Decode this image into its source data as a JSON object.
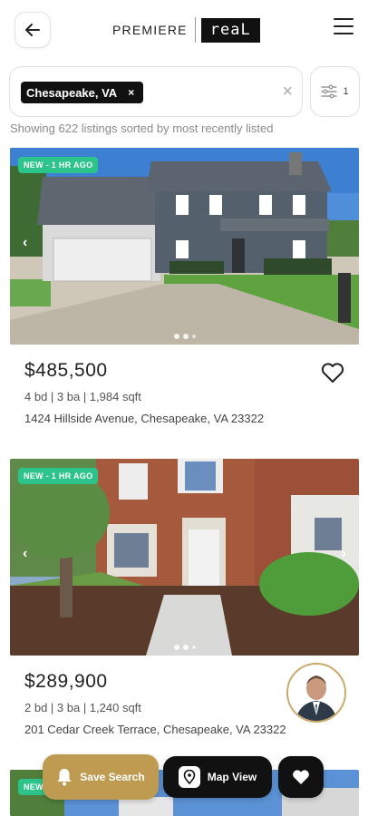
{
  "header": {
    "brand_left": "PREMIERE",
    "brand_right": "reaL"
  },
  "search": {
    "chip_label": "Chesapeake, VA",
    "chip_remove": "×",
    "clear": "×",
    "filter_count": "1"
  },
  "results": {
    "summary": "Showing 622 listings sorted by most recently listed"
  },
  "listings": [
    {
      "badge": "NEW - 1 HR AGO",
      "price": "$485,500",
      "specs": "4 bd | 3 ba | 1,984 sqft",
      "address": "1424 Hillside Avenue, Chesapeake, VA 23322",
      "nav_prev": "‹",
      "nav_next": "›"
    },
    {
      "badge": "NEW - 1 HR AGO",
      "price": "$289,900",
      "specs": "2 bd | 3 ba | 1,240 sqft",
      "address": "201 Cedar Creek Terrace, Chesapeake, VA 23322",
      "nav_prev": "‹",
      "nav_next": "›"
    },
    {
      "badge": "NEW"
    }
  ],
  "actions": {
    "save_search": "Save Search",
    "map_view": "Map View"
  },
  "colors": {
    "accent_gold": "#bf9b52",
    "badge_green": "#2cc48a",
    "dark": "#111111"
  },
  "icons": [
    "back-arrow-icon",
    "hamburger-menu-icon",
    "filter-sliders-icon",
    "heart-outline-icon",
    "bell-icon",
    "map-pin-icon",
    "heart-filled-icon"
  ]
}
